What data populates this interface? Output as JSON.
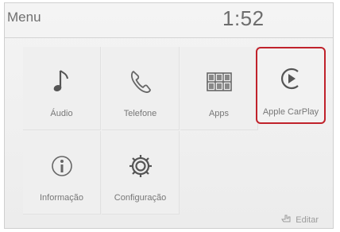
{
  "header": {
    "title": "Menu",
    "clock": "1:52"
  },
  "tiles": [
    {
      "label": "Áudio",
      "icon": "music-note-icon"
    },
    {
      "label": "Telefone",
      "icon": "phone-icon"
    },
    {
      "label": "Apps",
      "icon": "apps-grid-icon"
    },
    {
      "label": "Apple CarPlay",
      "icon": "carplay-icon",
      "highlight_color": "#c0222b"
    },
    {
      "label": "Informação",
      "icon": "info-icon"
    },
    {
      "label": "Configuração",
      "icon": "gear-icon"
    }
  ],
  "footer": {
    "edit_label": "Editar",
    "edit_icon": "edit-hand-icon"
  }
}
